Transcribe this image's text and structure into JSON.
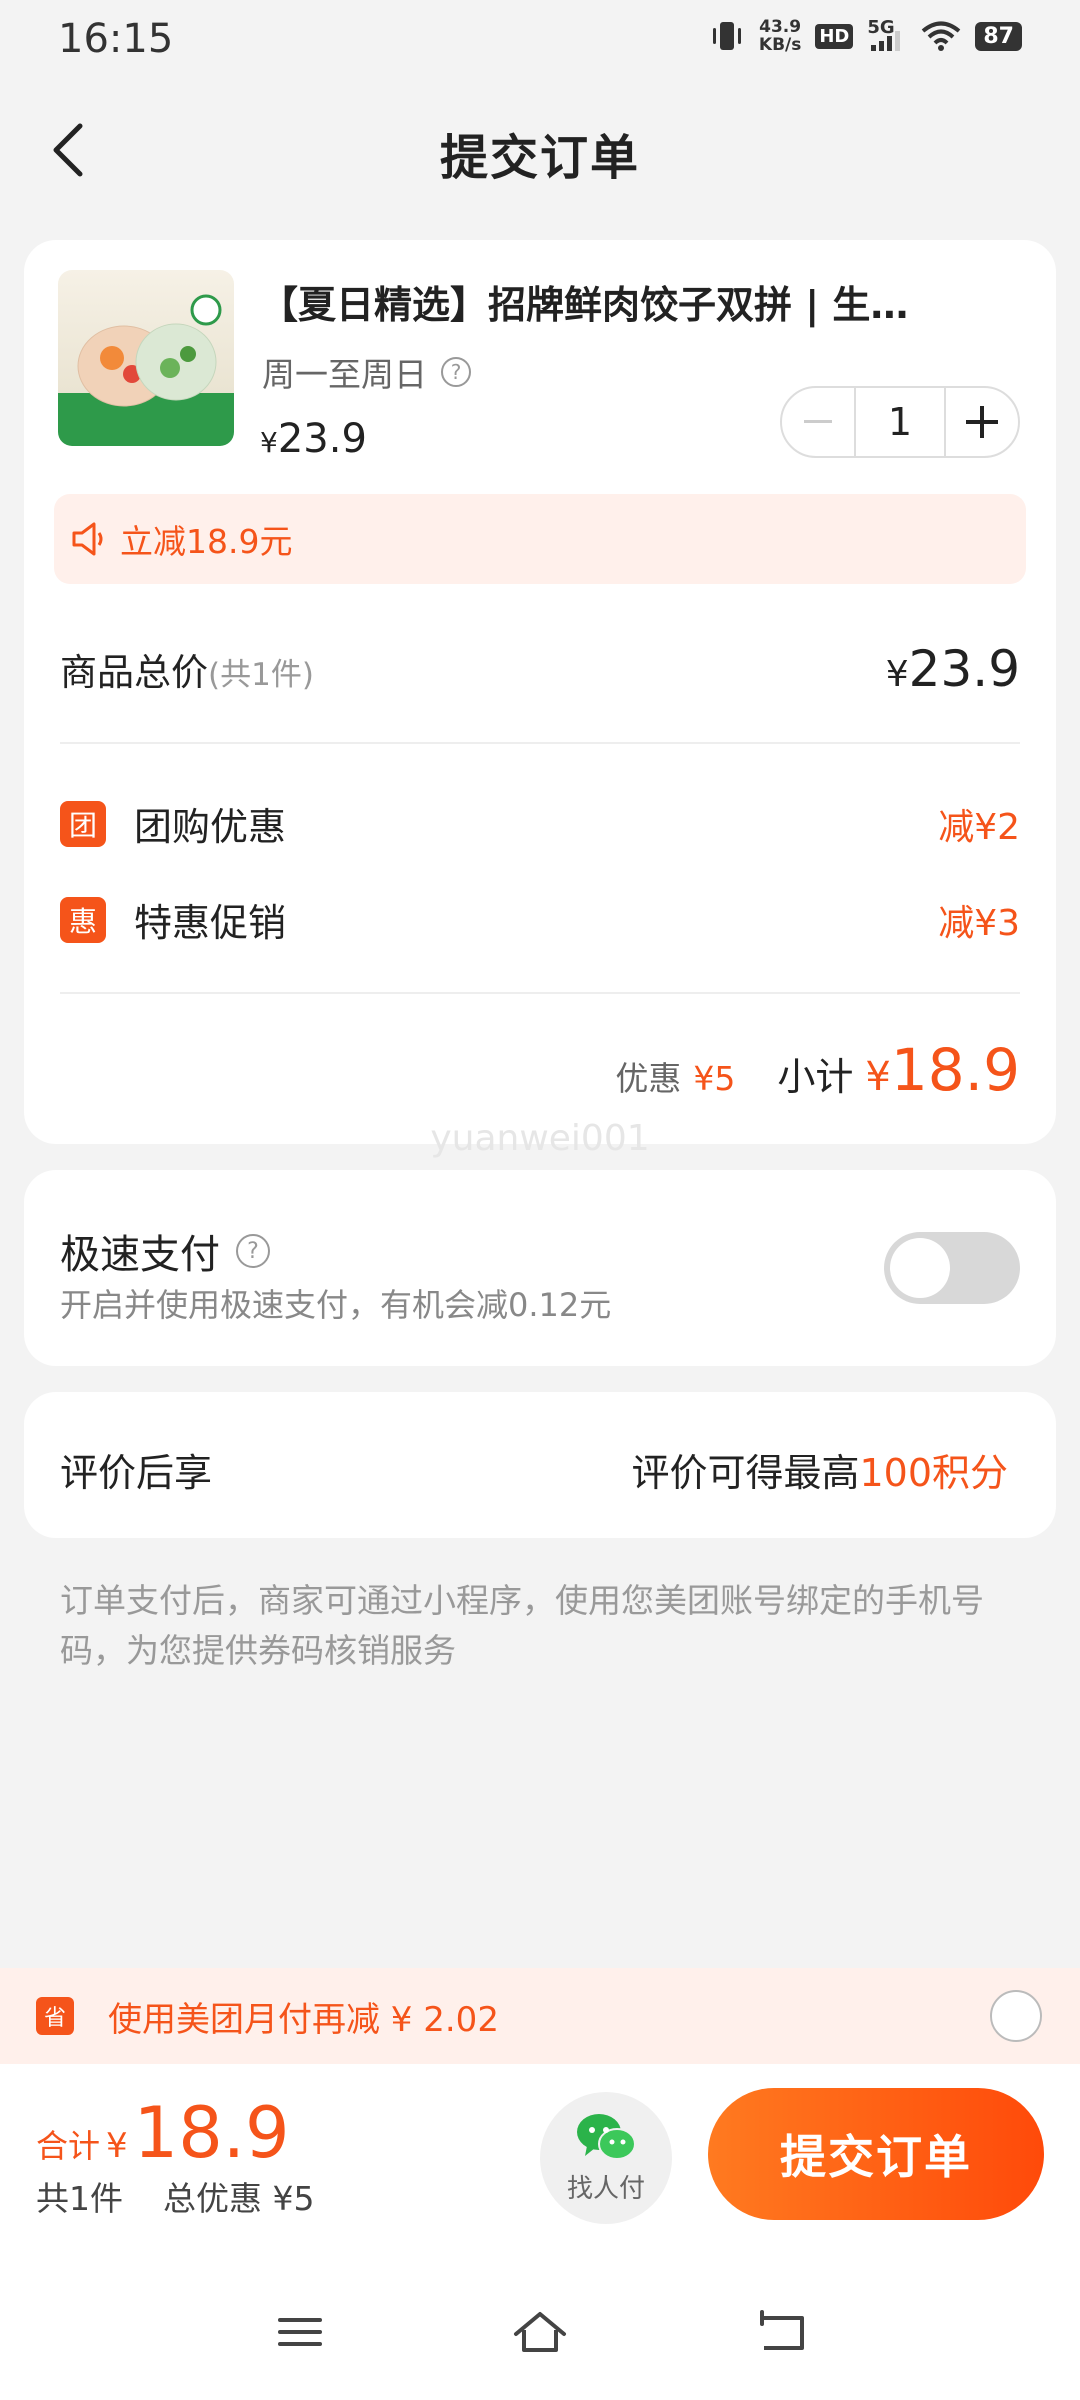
{
  "status_bar": {
    "time": "16:15",
    "net_speed_value": "43.9",
    "net_speed_unit": "KB/s",
    "hd": "HD",
    "network": "5G",
    "battery": "87"
  },
  "header": {
    "title": "提交订单"
  },
  "product": {
    "title": "【夏日精选】招牌鲜肉饺子双拼 | 生…",
    "validity": "周一至周日",
    "price_symbol": "¥",
    "price": "23.9",
    "quantity": "1",
    "discount_banner": "立减18.9元"
  },
  "order": {
    "total_label": "商品总价",
    "total_count": "(共1件)",
    "total_symbol": "¥",
    "total_value": "23.9",
    "promos": [
      {
        "badge": "团",
        "label": "团购优惠",
        "value": "减¥2"
      },
      {
        "badge": "惠",
        "label": "特惠促销",
        "value": "减¥3"
      }
    ],
    "discount_label": "优惠",
    "discount_value": "¥5",
    "subtotal_label": "小计",
    "subtotal_symbol": "¥",
    "subtotal_value": "18.9"
  },
  "watermark": "yuanwei001",
  "quick_pay": {
    "title": "极速支付",
    "description": "开启并使用极速支付，有机会减0.12元",
    "enabled": false
  },
  "review": {
    "left": "评价后享",
    "right_prefix": "评价可得最高",
    "right_highlight": "100积分"
  },
  "notice": "订单支付后，商家可通过小程序，使用您美团账号绑定的手机号码，为您提供券码核销服务",
  "monthly_pay": {
    "icon_text": "省",
    "text": "使用美团月付再减 ¥ 2.02",
    "selected": false
  },
  "bottom": {
    "sum_label": "合计",
    "sum_symbol": "¥",
    "sum_value": "18.9",
    "count_text": "共1件",
    "discount_text": "总优惠 ¥5",
    "friend_pay_label": "找人付",
    "submit_label": "提交订单"
  },
  "colors": {
    "accent": "#f5541a",
    "background": "#f3f3f3",
    "banner_bg": "#fff0eb"
  }
}
